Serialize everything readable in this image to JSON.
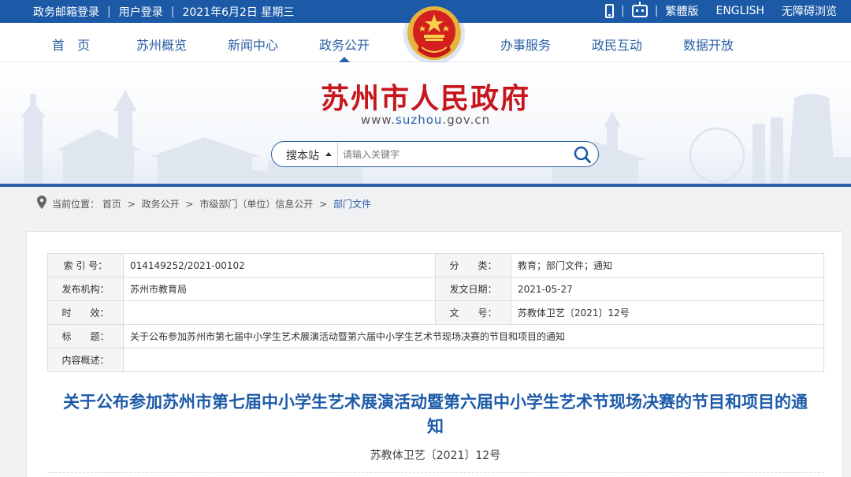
{
  "topbar": {
    "left": [
      "政务邮箱登录",
      "用户登录",
      "2021年6月2日 星期三"
    ],
    "right_links": [
      "繁體版",
      "ENGLISH",
      "无障碍浏览"
    ],
    "icons": [
      "mobile-icon",
      "robot-icon"
    ]
  },
  "nav": {
    "items": [
      "首　页",
      "苏州概览",
      "新闻中心",
      "政务公开",
      "办事服务",
      "政民互动",
      "数据开放"
    ],
    "active": "政务公开"
  },
  "banner": {
    "title": "苏州市人民政府",
    "url_prefix": "www.",
    "url_domain": "suzhou",
    "url_suffix": ".gov.cn"
  },
  "search": {
    "station_label": "搜本站",
    "placeholder": "请输入关键字",
    "icon": "search-icon"
  },
  "breadcrumb": {
    "label": "当前位置：",
    "items": [
      "首页",
      "政务公开",
      "市级部门（单位）信息公开",
      "部门文件"
    ],
    "separator": ">"
  },
  "meta": {
    "rows": [
      {
        "l1": "索 引 号：",
        "v1": "014149252/2021-00102",
        "l2": "分　　类：",
        "v2": "教育；部门文件；通知"
      },
      {
        "l1": "发布机构：",
        "v1": "苏州市教育局",
        "l2": "发文日期：",
        "v2": "2021-05-27"
      },
      {
        "l1": "时　　效：",
        "v1": "",
        "l2": "文　　号：",
        "v2": "苏教体卫艺〔2021〕12号"
      }
    ],
    "title_label": "标　　题：",
    "title_value": "关于公布参加苏州市第七届中小学生艺术展演活动暨第六届中小学生艺术节现场决赛的节目和项目的通知",
    "summary_label": "内容概述：",
    "summary_value": ""
  },
  "document": {
    "title": "关于公布参加苏州市第七届中小学生艺术展演活动暨第六届中小学生艺术节现场决赛的节目和项目的通知",
    "number": "苏教体卫艺〔2021〕12号"
  },
  "colors": {
    "brand_blue": "#1c5aa8",
    "title_red": "#c8161d"
  }
}
